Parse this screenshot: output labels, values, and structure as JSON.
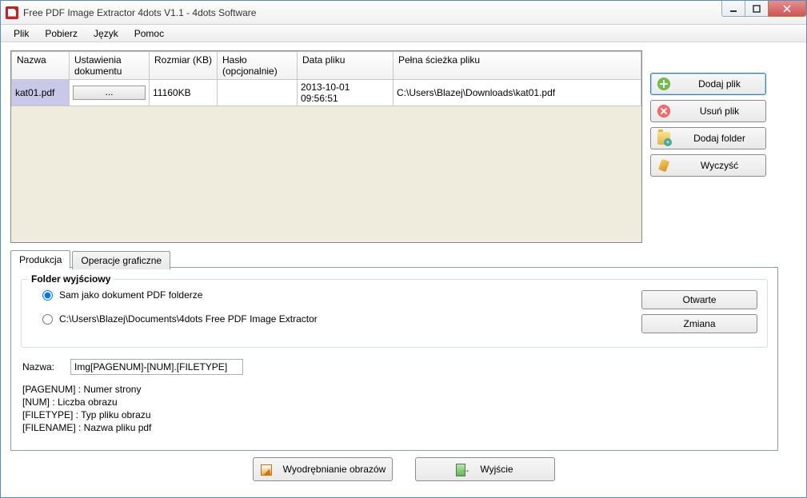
{
  "window": {
    "title": "Free PDF Image Extractor 4dots V1.1 - 4dots Software"
  },
  "menu": {
    "file": "Plik",
    "download": "Pobierz",
    "language": "Język",
    "help": "Pomoc"
  },
  "grid": {
    "columns": {
      "name": "Nazwa",
      "settings": "Ustawienia dokumentu",
      "size": "Rozmiar (KB)",
      "password": "Hasło (opcjonalnie)",
      "date": "Data pliku",
      "fullpath": "Pełna ścieżka pliku"
    },
    "rows": [
      {
        "name": "kat01.pdf",
        "settings": "...",
        "size": "11160KB",
        "password": "",
        "date": "2013-10-01 09:56:51",
        "fullpath": "C:\\Users\\Blazej\\Downloads\\kat01.pdf"
      }
    ]
  },
  "side": {
    "add_file": "Dodaj plik",
    "remove_file": "Usuń plik",
    "add_folder": "Dodaj folder",
    "clear": "Wyczyść"
  },
  "tabs": {
    "production": "Produkcja",
    "graphics": "Operacje graficzne"
  },
  "output": {
    "legend": "Folder wyjściowy",
    "radio_same": "Sam jako dokument PDF folderze",
    "radio_path": "C:\\Users\\Blazej\\Documents\\4dots Free PDF Image Extractor",
    "btn_open": "Otwarte",
    "btn_change": "Zmiana",
    "name_label": "Nazwa:",
    "name_value": "Img[PAGENUM]-[NUM].[FILETYPE]",
    "hint_pagenum": "[PAGENUM] : Numer strony",
    "hint_num": "[NUM] : Liczba obrazu",
    "hint_filetype": "[FILETYPE] : Typ pliku obrazu",
    "hint_filename": "[FILENAME] : Nazwa pliku pdf"
  },
  "bottom": {
    "extract": "Wyodrębnianie obrazów",
    "exit": "Wyjście"
  }
}
